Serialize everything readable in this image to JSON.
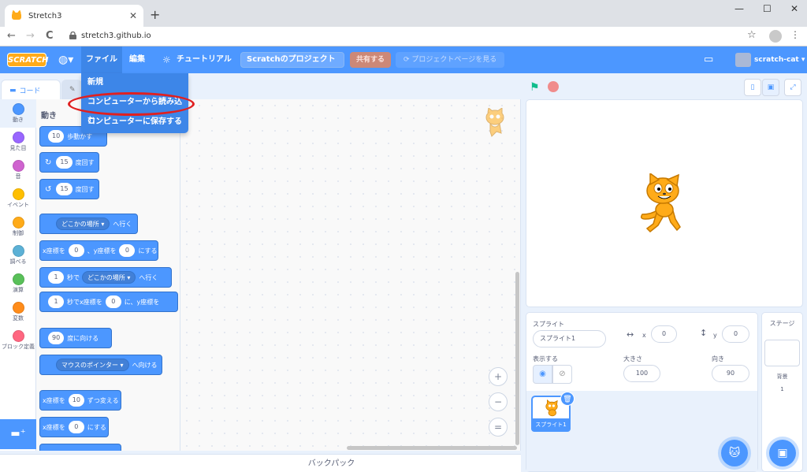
{
  "browser": {
    "tab_title": "Stretch3",
    "url": "stretch3.github.io",
    "new_tab": "+",
    "tab_close": "✕",
    "back": "←",
    "forward": "→",
    "reload": "C",
    "minimize": "—",
    "maximize": "☐",
    "close": "✕"
  },
  "menubar": {
    "logo": "SCRATCH",
    "file": "ファイル",
    "edit": "編集",
    "tutorial": "チュートリアル",
    "project_title": "Scratchのプロジェクト",
    "share": "共有する",
    "project_page": "プロジェクトページを見る",
    "username": "scratch-cat"
  },
  "file_menu": {
    "items": [
      "新規",
      "コンピューターから読み込む",
      "コンピューターに保存する"
    ],
    "highlighted": "コンピューターから読み込む"
  },
  "editor_tabs": {
    "code": "コード"
  },
  "categories": [
    {
      "name": "動き",
      "color": "#4c97ff"
    },
    {
      "name": "見た目",
      "color": "#9966ff"
    },
    {
      "name": "音",
      "color": "#cf63cf"
    },
    {
      "name": "イベント",
      "color": "#ffbf00"
    },
    {
      "name": "制御",
      "color": "#ffab19"
    },
    {
      "name": "調べる",
      "color": "#5cb1d6"
    },
    {
      "name": "演算",
      "color": "#59c059"
    },
    {
      "name": "変数",
      "color": "#ff8c1a"
    },
    {
      "name": "ブロック定義",
      "color": "#ff6680"
    }
  ],
  "palette": {
    "heading": "動き",
    "blocks": {
      "move": {
        "value": "10",
        "text": "歩動かす"
      },
      "turn_right": {
        "value": "15",
        "text": "度回す"
      },
      "turn_left": {
        "value": "15",
        "text": "度回す"
      },
      "goto": {
        "dropdown": "どこかの場所",
        "text": "へ行く"
      },
      "goto_xy": {
        "x_label": "x座標を",
        "x": "0",
        "sep": "、y座標を",
        "y": "0",
        "text": "にする"
      },
      "glide": {
        "value": "1",
        "mid": "秒で",
        "dropdown": "どこかの場所",
        "text": "へ行く"
      },
      "glide_xy": {
        "value": "1",
        "mid": "秒でx座標を",
        "x": "0",
        "sep": "に、y座標を"
      },
      "point_dir": {
        "value": "90",
        "text": "度に向ける"
      },
      "point_towards": {
        "dropdown": "マウスのポインター",
        "text": "へ向ける"
      },
      "change_x": {
        "label": "x座標を",
        "value": "10",
        "text": "ずつ変える"
      },
      "set_x": {
        "label": "x座標を",
        "value": "0",
        "text": "にする"
      }
    }
  },
  "zoom": {
    "in": "+",
    "out": "−",
    "reset": "="
  },
  "backpack": "バックパック",
  "sprite_info": {
    "sprite_label": "スプライト",
    "sprite_name": "スプライト1",
    "x_label": "x",
    "x_value": "0",
    "y_label": "y",
    "y_value": "0",
    "show_label": "表示する",
    "size_label": "大きさ",
    "size_value": "100",
    "direction_label": "向き",
    "direction_value": "90",
    "thumb_name": "スプライト1"
  },
  "stage_panel": {
    "title": "ステージ",
    "backdrop_label": "背景",
    "backdrop_count": "1"
  }
}
